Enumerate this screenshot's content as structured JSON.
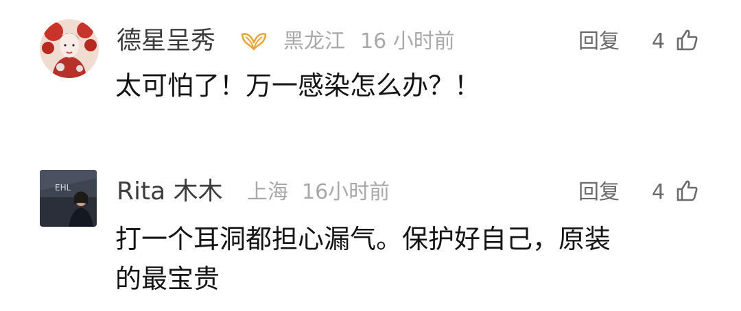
{
  "comments": [
    {
      "username": "德星呈秀",
      "badge_icon": "vip-badge-icon",
      "location": "黑龙江",
      "time": "16 小时前",
      "reply_label": "回复",
      "likes": "4",
      "text": "太可怕了！万一感染怎么办？！",
      "avatar_icon": "avatar-illustration"
    },
    {
      "username": "Rita 木木",
      "location": "上海",
      "time": "16小时前",
      "reply_label": "回复",
      "likes": "4",
      "text_line1": "打一个耳洞都担心漏气。保护好自己，原装",
      "text_line2": "的最宝贵",
      "avatar_icon": "avatar-photo",
      "avatar_text": "EHL"
    }
  ],
  "colors": {
    "username": "#3c3c3c",
    "meta": "#a8a8a8",
    "action": "#6a6a6a",
    "body_text": "#141414",
    "badge": "#e8a53a"
  }
}
